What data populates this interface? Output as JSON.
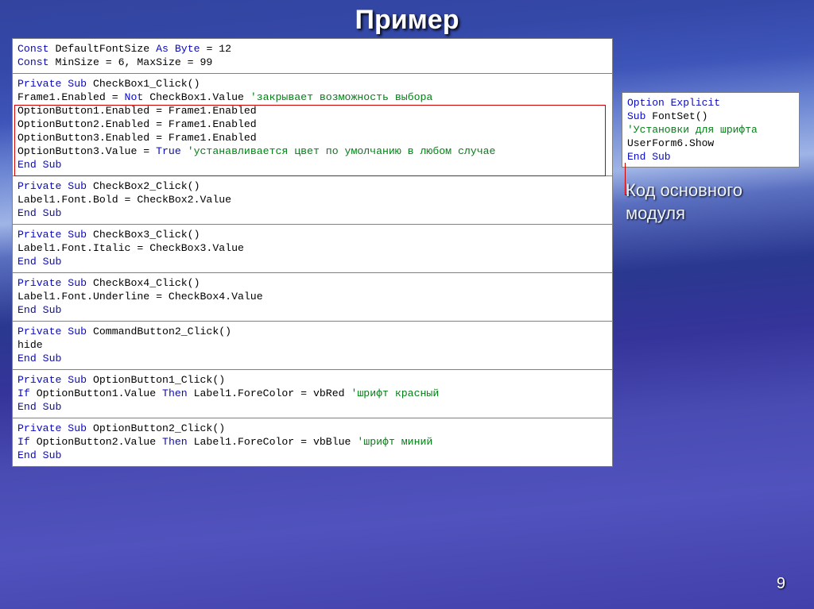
{
  "slide": {
    "title": "Пример",
    "page_number": "9",
    "caption": "Код основного модуля"
  },
  "main_code": {
    "s1": {
      "l1a": "Const",
      "l1b": " DefaultFontSize ",
      "l1c": "As Byte",
      "l1d": " = 12",
      "l2a": "Const",
      "l2b": " MinSize = 6, MaxSize = 99"
    },
    "s2": {
      "l1a": "Private Sub",
      "l1b": " CheckBox1_Click()",
      "l2a": "Frame1.Enabled = ",
      "l2b": "Not",
      "l2c": " CheckBox1.Value ",
      "l2d": "'закрывает возможность выбора",
      "l3": "OptionButton1.Enabled = Frame1.Enabled",
      "l4": "OptionButton2.Enabled = Frame1.Enabled",
      "l5": "OptionButton3.Enabled = Frame1.Enabled",
      "l6a": "OptionButton3.Value = ",
      "l6b": "True ",
      "l6c": "'устанавливается цвет по умолчанию в любом случае",
      "l7": "End Sub"
    },
    "s3": {
      "l1a": "Private Sub",
      "l1b": " CheckBox2_Click()",
      "l2": "Label1.Font.Bold = CheckBox2.Value",
      "l3": "End Sub"
    },
    "s4": {
      "l1a": "Private Sub",
      "l1b": " CheckBox3_Click()",
      "l2": "Label1.Font.Italic = CheckBox3.Value",
      "l3": "End Sub"
    },
    "s5": {
      "l1a": "Private Sub",
      "l1b": " CheckBox4_Click()",
      "l2": "Label1.Font.Underline = CheckBox4.Value",
      "l3": "End Sub"
    },
    "s6": {
      "l1a": "Private Sub",
      "l1b": " CommandButton2_Click()",
      "l2": "hide",
      "l3": "End Sub"
    },
    "s7": {
      "l1a": "Private Sub",
      "l1b": " OptionButton1_Click()",
      "l2a": "If",
      "l2b": " OptionButton1.Value ",
      "l2c": "Then",
      "l2d": " Label1.ForeColor = vbRed ",
      "l2e": "'шрифт красный",
      "l3": "End Sub"
    },
    "s8": {
      "l1a": "Private Sub",
      "l1b": " OptionButton2_Click()",
      "l2a": "If",
      "l2b": " OptionButton2.Value ",
      "l2c": "Then",
      "l2d": " Label1.ForeColor = vbBlue ",
      "l2e": "'шрифт миний",
      "l3": "End Sub"
    }
  },
  "module_code": {
    "l1": "Option Explicit",
    "l2a": "Sub",
    "l2b": " FontSet()",
    "l3": "'Установки для шрифта",
    "l4": "UserForm6.Show",
    "l5": "End Sub"
  }
}
